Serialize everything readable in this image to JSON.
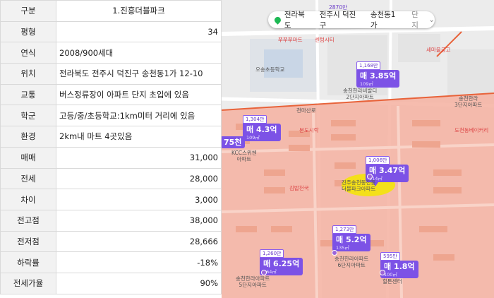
{
  "sheet": {
    "rows": [
      {
        "label": "구분",
        "value": "1.진흥더블파크"
      },
      {
        "label": "평형",
        "value": "34"
      },
      {
        "label": "연식",
        "value": "2008/900세대"
      },
      {
        "label": "위치",
        "value": "전라북도 전주시 덕진구 송천동1가 12-10"
      },
      {
        "label": "교통",
        "value": " 버스정류장이 아파트 단지 초입에 있음"
      },
      {
        "label": "학군",
        "value": "고등/중/초등학교:1km미터 거리에 있음"
      },
      {
        "label": "환경",
        "value": " 2km내 마트 4곳있음"
      },
      {
        "label": "매매",
        "value": "31,000"
      },
      {
        "label": "전세",
        "value": "28,000"
      },
      {
        "label": "차이",
        "value": "3,000"
      },
      {
        "label": "전고점",
        "value": "38,000"
      },
      {
        "label": "전저점",
        "value": "28,666"
      },
      {
        "label": "하락률",
        "value": "-18%"
      },
      {
        "label": "전세가율",
        "value": "90%"
      }
    ]
  },
  "map": {
    "location": {
      "province": "전라북도",
      "city": "전주시 덕진구",
      "dong": "송천동1가",
      "filter": "단지",
      "chevron": "chevron-down-icon"
    },
    "markers": [
      {
        "size": "1,168만",
        "price": "매 3.85억",
        "area": "109㎡"
      },
      {
        "size": "1,304만",
        "price": "매 4.3억",
        "area": "109㎡"
      },
      {
        "size": "1,006만",
        "price": "매 3.47억",
        "area": "114㎡"
      },
      {
        "size": "1,273만",
        "price": "매 5.2억",
        "area": "135㎡"
      },
      {
        "size": "1,260만",
        "price": "매 6.25억",
        "area": "164㎡"
      },
      {
        "size": "595만",
        "price": "매 1.8억",
        "area": "100㎡"
      },
      {
        "size": "",
        "price": "75천",
        "area": ""
      }
    ],
    "labels": {
      "school1": "오송초등학교",
      "apt1": "송천한라비발디\n2단지아파트",
      "road1": "천마산로",
      "market": "본도시락",
      "apt2": "KCC스위첸\n아파트",
      "target": "진주송천동진흥\n더블파크아파트",
      "kimbap": "김밥천국",
      "apt3": "송천한라아파트\n6단지아파트",
      "apt4": "송천한라아파트\n5단지아파트",
      "store": "힐튼센터",
      "hanra1": "송천한라\n3단지아파트",
      "bakery": "도천동베이커리",
      "sema": "세마을금고",
      "top1": "쭈쭈쭈마트",
      "top2": "센텀시티",
      "ctop": "2870만"
    },
    "colors": {
      "zone": "#f5b5a5",
      "road": "#e8633a",
      "marker": "#7c52e6",
      "highlight": "#f3e600"
    }
  }
}
